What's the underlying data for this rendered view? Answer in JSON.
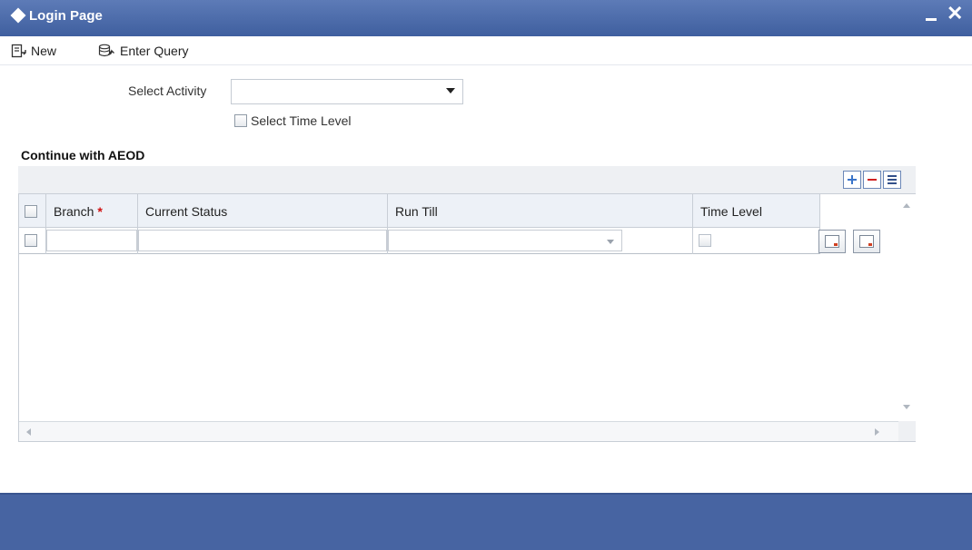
{
  "window": {
    "title": "Login Page",
    "colors": {
      "titlebar": "#4a69a8",
      "footer": "#4764a2",
      "required": "#d01010"
    }
  },
  "toolbar": {
    "new_label": "New",
    "enter_query_label": "Enter Query"
  },
  "form": {
    "select_activity_label": "Select Activity",
    "select_activity_value": "",
    "select_time_level_label": "Select Time Level",
    "select_time_level_checked": false
  },
  "section": {
    "title": "Continue with AEOD"
  },
  "grid": {
    "columns": [
      {
        "label": "Branch",
        "required_mark": "*"
      },
      {
        "label": "Current Status"
      },
      {
        "label": "Run Till"
      },
      {
        "label": "Time Level"
      }
    ],
    "rows": [
      {
        "branch": "",
        "current_status": "",
        "run_till": "",
        "time_level_checked": false
      }
    ],
    "toolbar_icons": [
      "add-row-icon",
      "delete-row-icon",
      "single-view-icon"
    ]
  }
}
